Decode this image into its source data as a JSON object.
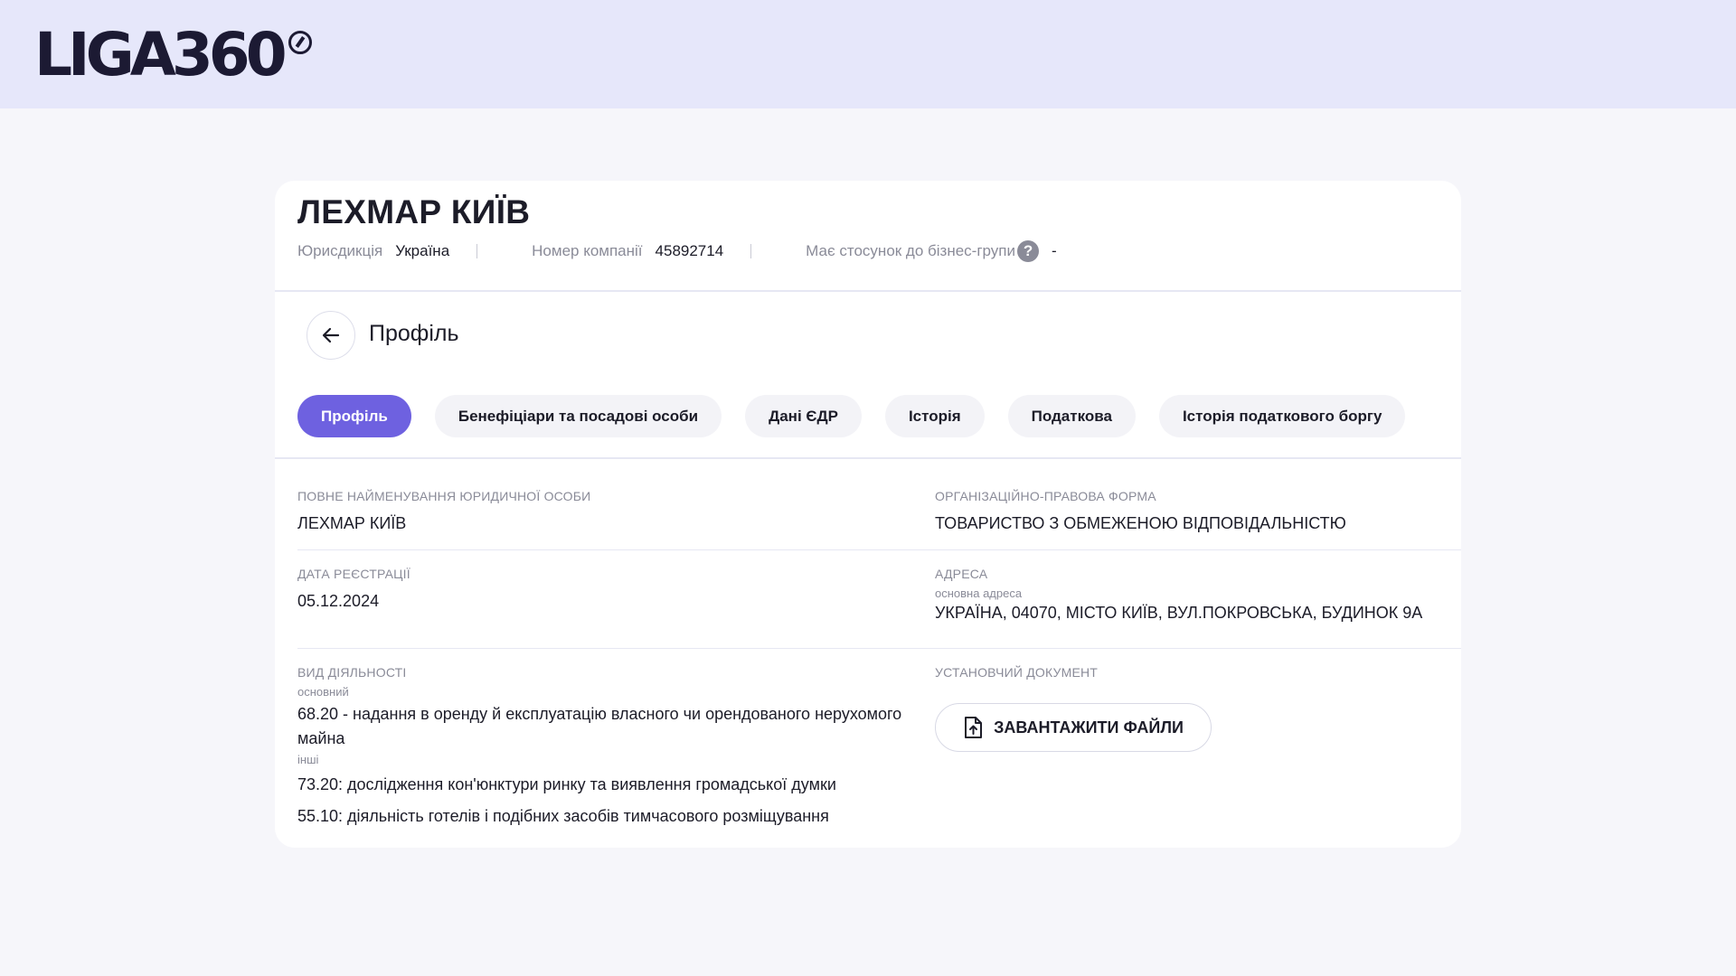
{
  "brand": {
    "logo_text": "LIGA360"
  },
  "company": {
    "name": "ЛЕХМАР КИЇВ",
    "jurisdiction_label": "Юрисдикція",
    "jurisdiction_value": "Україна",
    "number_label": "Номер компанії",
    "number_value": "45892714",
    "group_label": "Має стосунок до бізнес-групи",
    "group_help": "?",
    "group_value": "-"
  },
  "section": {
    "title": "Профіль",
    "back_icon": "arrow-left-icon"
  },
  "tabs": [
    {
      "label": "Профіль",
      "active": true
    },
    {
      "label": "Бенефіціари та посадові особи",
      "active": false
    },
    {
      "label": "Дані ЄДР",
      "active": false
    },
    {
      "label": "Історія",
      "active": false
    },
    {
      "label": "Податкова",
      "active": false
    },
    {
      "label": "Історія податкового боргу",
      "active": false
    }
  ],
  "profile": {
    "full_name_label": "ПОВНЕ НАЙМЕНУВАННЯ ЮРИДИЧНОЇ ОСОБИ",
    "full_name_value": "ЛЕХМАР КИЇВ",
    "legal_form_label": "ОРГАНІЗАЦІЙНО-ПРАВОВА ФОРМА",
    "legal_form_value": "ТОВАРИСТВО З ОБМЕЖЕНОЮ ВІДПОВІДАЛЬНІСТЮ",
    "reg_date_label": "ДАТА РЕЄСТРАЦІЇ",
    "reg_date_value": "05.12.2024",
    "address_label": "АДРЕСА",
    "address_sublabel": "основна адреса",
    "address_value": "УКРАЇНА, 04070, МІСТО КИЇВ, ВУЛ.ПОКРОВСЬКА, БУДИНОК 9А",
    "activity_label": "ВИД ДІЯЛЬНОСТІ",
    "activity_main_sublabel": "основний",
    "activity_main_value": "68.20 - надання в оренду й експлуатацію власного чи орендованого нерухомого майна",
    "activity_other_sublabel": "інші",
    "activity_other_1": "73.20: дослідження кон'юнктури ринку та виявлення громадської думки",
    "activity_other_2": "55.10: діяльність готелів і подібних засобів тимчасового розміщування",
    "document_label": "УСТАНОВЧИЙ ДОКУМЕНТ",
    "upload_label": "ЗАВАНТАЖИТИ ФАЙЛИ",
    "upload_icon": "file-upload-icon"
  },
  "colors": {
    "accent": "#6e61e0",
    "topbar": "#e6e7fa",
    "background": "#f6f6fa"
  }
}
